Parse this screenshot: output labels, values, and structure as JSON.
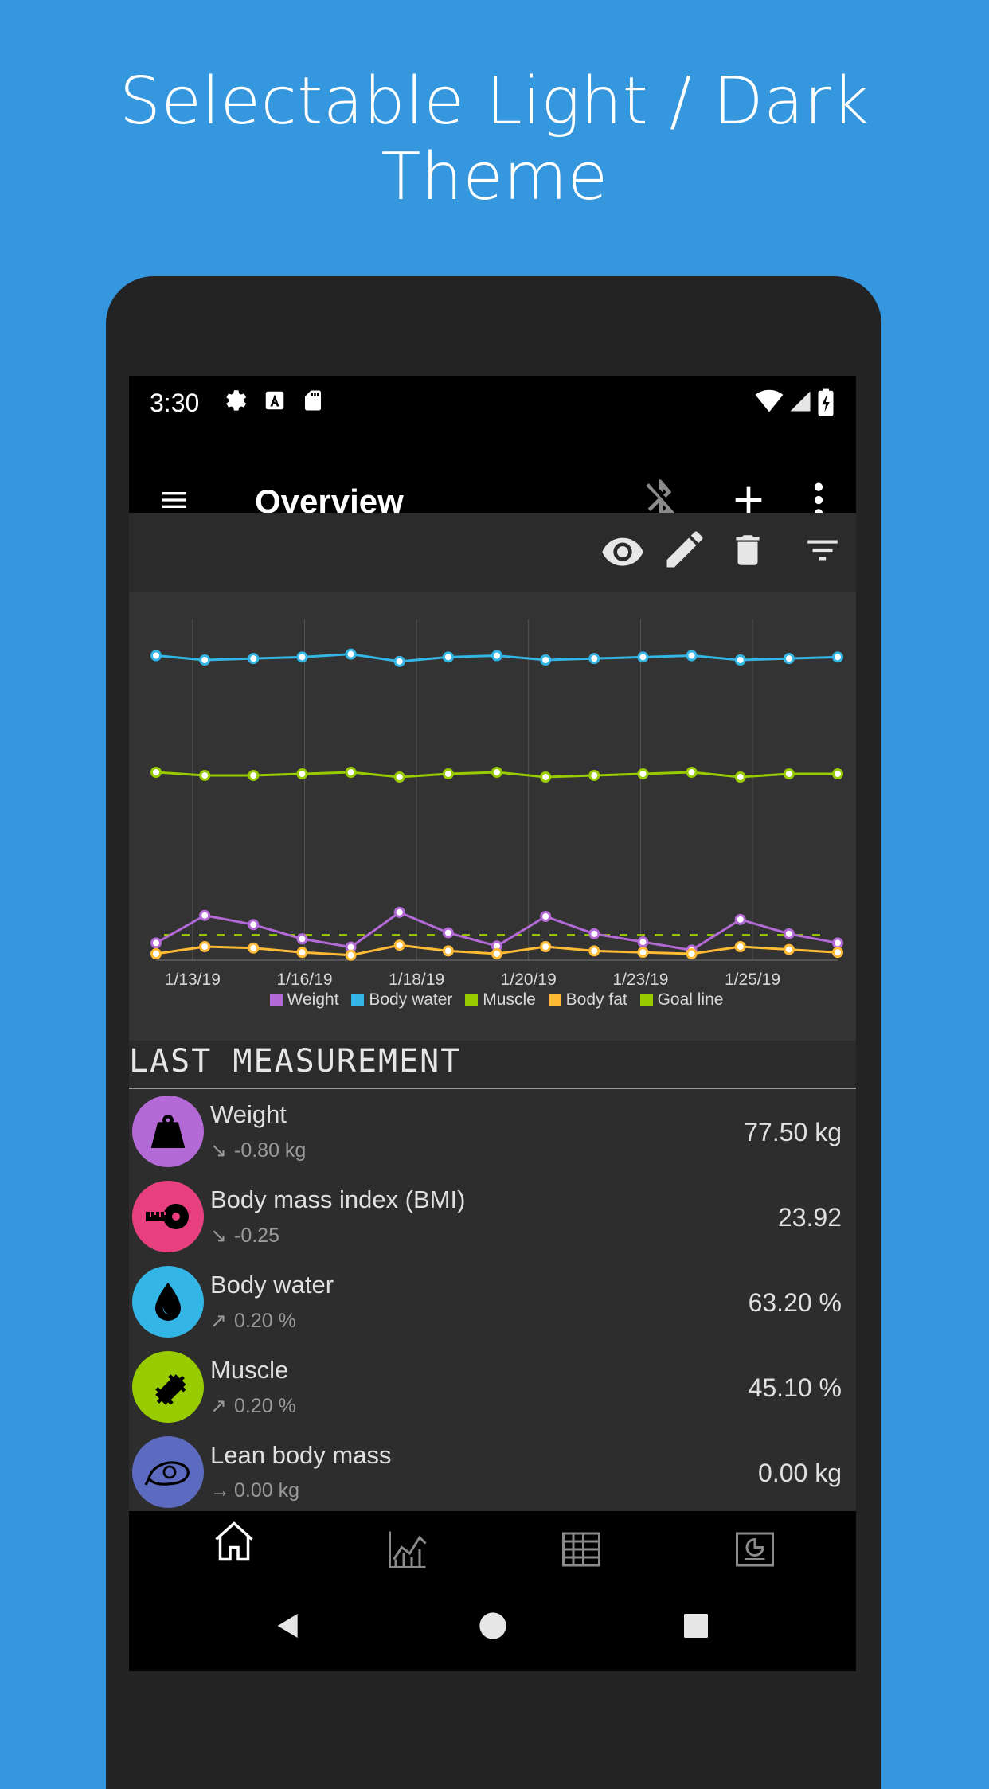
{
  "promo": {
    "title": "Selectable Light / Dark Theme"
  },
  "status_bar": {
    "time": "3:30"
  },
  "app_bar": {
    "title": "Overview"
  },
  "colors": {
    "weight": "#b36ad6",
    "bmi": "#e8407e",
    "body_water": "#33b5e5",
    "muscle": "#99cc00",
    "body_fat": "#ffbb33",
    "lean_body_mass": "#5c6bc0",
    "goal_line": "#99cc00"
  },
  "chart_data": {
    "type": "line",
    "x_ticks": [
      "1/13/19",
      "1/16/19",
      "1/18/19",
      "1/20/19",
      "1/23/19",
      "1/25/19"
    ],
    "legend": [
      "Weight",
      "Body water",
      "Muscle",
      "Body fat",
      "Goal line"
    ],
    "n_points": 15,
    "series": [
      {
        "name": "Body water",
        "color": "#33b5e5",
        "values": [
          63.3,
          63.0,
          63.1,
          63.2,
          63.4,
          62.9,
          63.2,
          63.3,
          63.0,
          63.1,
          63.2,
          63.3,
          63.0,
          63.1,
          63.2
        ]
      },
      {
        "name": "Muscle",
        "color": "#99cc00",
        "values": [
          45.2,
          45.0,
          45.0,
          45.1,
          45.2,
          44.9,
          45.1,
          45.2,
          44.9,
          45.0,
          45.1,
          45.2,
          44.9,
          45.1,
          45.1
        ]
      },
      {
        "name": "Weight",
        "color": "#b36ad6",
        "values": [
          76.3,
          79.0,
          78.1,
          76.7,
          75.9,
          79.3,
          77.3,
          76.0,
          78.9,
          77.2,
          76.4,
          75.6,
          78.6,
          77.2,
          76.3
        ]
      },
      {
        "name": "Body fat",
        "color": "#ffbb33",
        "values": [
          20.0,
          20.5,
          20.4,
          20.1,
          19.9,
          20.6,
          20.2,
          20.0,
          20.5,
          20.2,
          20.1,
          20.0,
          20.5,
          20.3,
          20.1
        ]
      }
    ],
    "goal_line": {
      "name": "Goal line",
      "color": "#99cc00",
      "value": 77.1
    }
  },
  "last_measurement": {
    "title": "LAST MEASUREMENT",
    "items": [
      {
        "name": "Weight",
        "delta": "-0.80 kg",
        "trend": "down",
        "value": "77.50 kg",
        "color": "#b36ad6",
        "icon": "weight-icon"
      },
      {
        "name": "Body mass index (BMI)",
        "delta": "-0.25",
        "trend": "down",
        "value": "23.92",
        "color": "#e8407e",
        "icon": "tape-measure-icon"
      },
      {
        "name": "Body water",
        "delta": "0.20 %",
        "trend": "up",
        "value": "63.20 %",
        "color": "#33b5e5",
        "icon": "water-drop-icon"
      },
      {
        "name": "Muscle",
        "delta": "0.20 %",
        "trend": "up",
        "value": "45.10 %",
        "color": "#99cc00",
        "icon": "dumbbell-icon"
      },
      {
        "name": "Lean body mass",
        "delta": "0.00 kg",
        "trend": "flat",
        "value": "0.00 kg",
        "color": "#5c6bc0",
        "icon": "meat-icon"
      }
    ]
  }
}
